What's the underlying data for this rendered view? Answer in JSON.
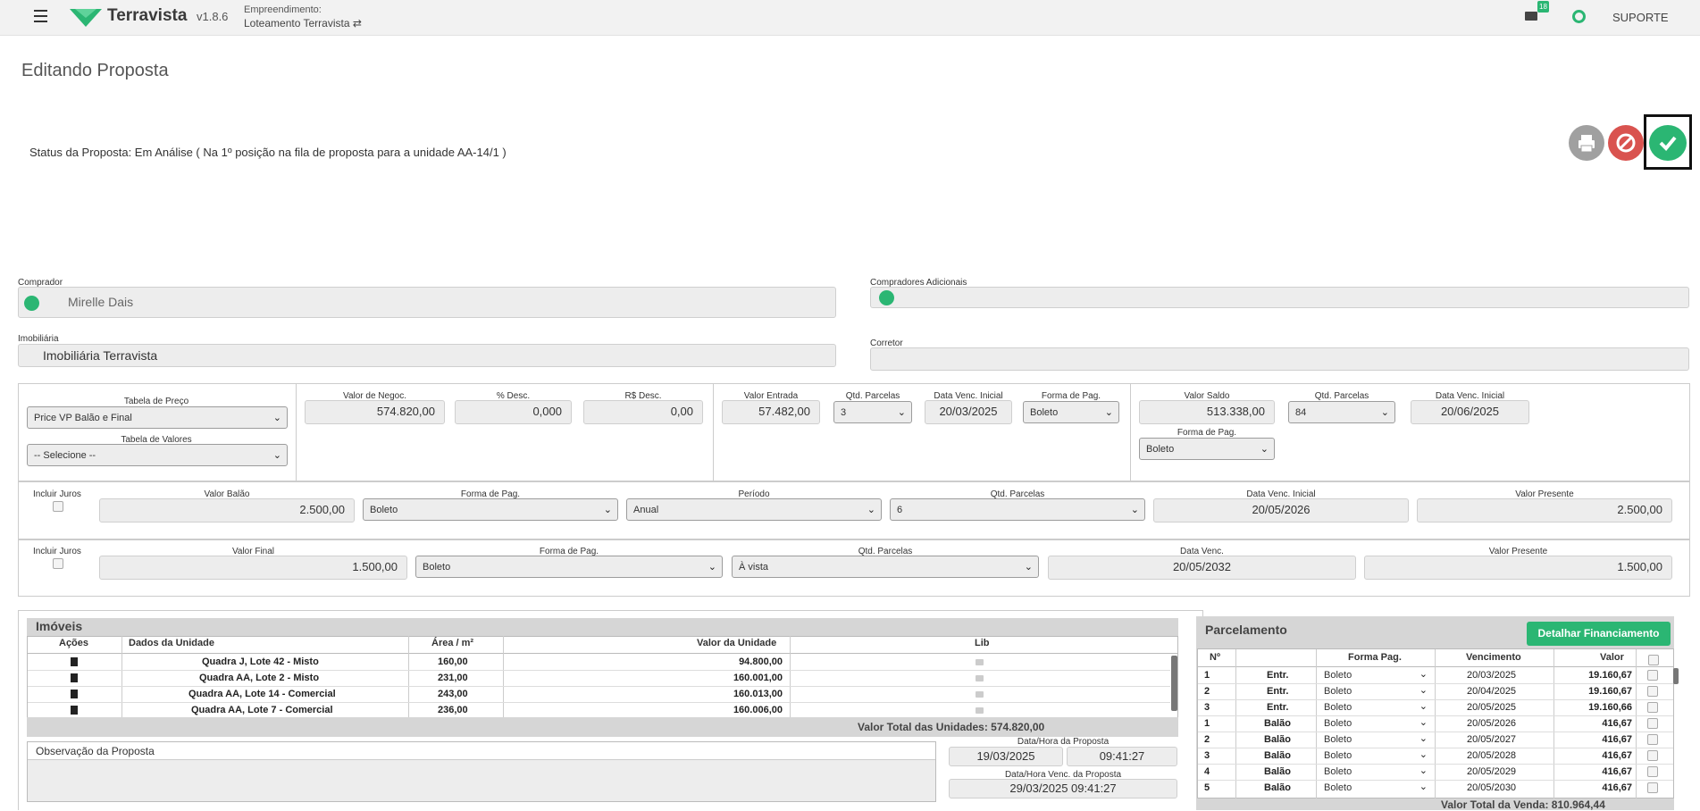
{
  "header": {
    "brand": "Terravista",
    "version": "v1.8.6",
    "project_label": "Empreendimento:",
    "project_name": "Loteamento Terravista ⇄",
    "mail_badge": "18",
    "support": "SUPORTE",
    "accent": "#2bb673"
  },
  "page": {
    "title": "Editando Proposta",
    "status": "Status da Proposta: Em Análise ( Na 1º posição na fila de proposta para a unidade AA-14/1 )"
  },
  "buyer": {
    "comprador_label": "Comprador",
    "comprador_value": "Mirelle Dais",
    "adicionais_label": "Compradores Adicionais",
    "imobiliaria_label": "Imobiliária",
    "imobiliaria_value": "Imobiliária Terravista",
    "corretor_label": "Corretor"
  },
  "pricing": {
    "tabela_preco_label": "Tabela de Preço",
    "tabela_preco_value": "Price VP Balão e Final",
    "tabela_valores_label": "Tabela de Valores",
    "tabela_valores_value": "-- Selecione --",
    "valor_negoc_label": "Valor de Negoc.",
    "valor_negoc": "574.820,00",
    "pct_desc_label": "% Desc.",
    "pct_desc": "0,000",
    "rs_desc_label": "R$ Desc.",
    "rs_desc": "0,00",
    "valor_entrada_label": "Valor Entrada",
    "valor_entrada": "57.482,00",
    "qtd_parcelas_label": "Qtd. Parcelas",
    "entrada_qtd": "3",
    "data_venc_label": "Data Venc. Inicial",
    "entrada_data": "20/03/2025",
    "forma_pag_label": "Forma de Pag.",
    "entrada_forma": "Boleto",
    "valor_saldo_label": "Valor Saldo",
    "valor_saldo": "513.338,00",
    "saldo_qtd": "84",
    "saldo_data": "20/06/2025",
    "saldo_forma": "Boleto"
  },
  "balao": {
    "incluir_juros": "Incluir Juros",
    "valor_label": "Valor Balão",
    "valor": "2.500,00",
    "forma_label": "Forma de Pag.",
    "forma": "Boleto",
    "periodo_label": "Período",
    "periodo": "Anual",
    "qtd_label": "Qtd. Parcelas",
    "qtd": "6",
    "data_label": "Data Venc. Inicial",
    "data": "20/05/2026",
    "vp_label": "Valor Presente",
    "vp": "2.500,00"
  },
  "final": {
    "incluir_juros": "Incluir Juros",
    "valor_label": "Valor Final",
    "valor": "1.500,00",
    "forma_label": "Forma de Pag.",
    "forma": "Boleto",
    "qtd_label": "Qtd. Parcelas",
    "qtd": "À vista",
    "data_label": "Data Venc.",
    "data": "20/05/2032",
    "vp_label": "Valor Presente",
    "vp": "1.500,00"
  },
  "imoveis": {
    "title": "Imóveis",
    "headers": [
      "Ações",
      "Dados da Unidade",
      "Área / m²",
      "Valor da Unidade",
      "Lib"
    ],
    "rows": [
      {
        "dados": "Quadra J, Lote 42 - Misto",
        "area": "160,00",
        "valor": "94.800,00"
      },
      {
        "dados": "Quadra AA, Lote 2 - Misto",
        "area": "231,00",
        "valor": "160.001,00"
      },
      {
        "dados": "Quadra AA, Lote 14 - Comercial",
        "area": "243,00",
        "valor": "160.013,00"
      },
      {
        "dados": "Quadra AA, Lote 7 - Comercial",
        "area": "236,00",
        "valor": "160.006,00"
      }
    ],
    "total": "Valor Total das Unidades: 574.820,00"
  },
  "observacao": {
    "title": "Observação da Proposta",
    "data_label": "Data/Hora da Proposta",
    "data": "19/03/2025",
    "hora": "09:41:27",
    "venc_label": "Data/Hora Venc. da Proposta",
    "venc": "29/03/2025 09:41:27"
  },
  "parcelamento": {
    "title": "Parcelamento",
    "button": "Detalhar Financiamento",
    "headers": [
      "Nº",
      "Forma Pag.",
      "Vencimento",
      "Valor"
    ],
    "rows": [
      {
        "n": "1",
        "tipo": "Entr.",
        "forma": "Boleto",
        "venc": "20/03/2025",
        "valor": "19.160,67"
      },
      {
        "n": "2",
        "tipo": "Entr.",
        "forma": "Boleto",
        "venc": "20/04/2025",
        "valor": "19.160,67"
      },
      {
        "n": "3",
        "tipo": "Entr.",
        "forma": "Boleto",
        "venc": "20/05/2025",
        "valor": "19.160,66"
      },
      {
        "n": "1",
        "tipo": "Balão",
        "forma": "Boleto",
        "venc": "20/05/2026",
        "valor": "416,67"
      },
      {
        "n": "2",
        "tipo": "Balão",
        "forma": "Boleto",
        "venc": "20/05/2027",
        "valor": "416,67"
      },
      {
        "n": "3",
        "tipo": "Balão",
        "forma": "Boleto",
        "venc": "20/05/2028",
        "valor": "416,67"
      },
      {
        "n": "4",
        "tipo": "Balão",
        "forma": "Boleto",
        "venc": "20/05/2029",
        "valor": "416,67"
      },
      {
        "n": "5",
        "tipo": "Balão",
        "forma": "Boleto",
        "venc": "20/05/2030",
        "valor": "416,67"
      }
    ],
    "total": "Valor Total da Venda: 810.964,44"
  }
}
